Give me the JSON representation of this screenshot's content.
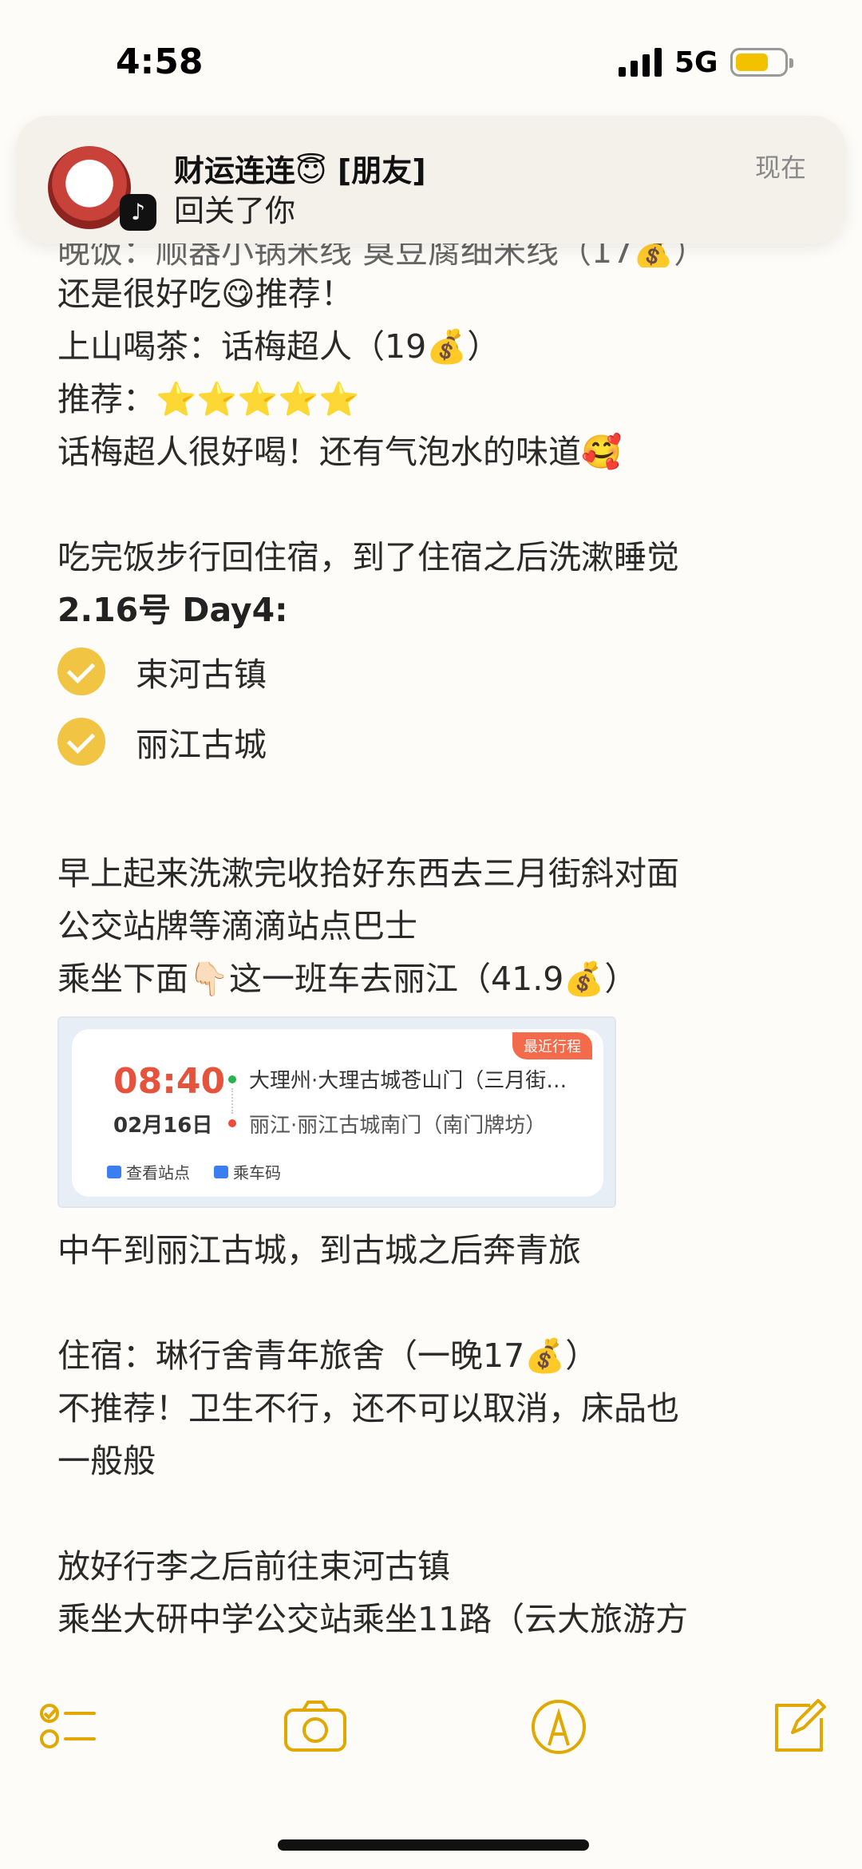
{
  "status_bar": {
    "time": "4:58",
    "network": "5G"
  },
  "notification": {
    "app_icon": "tiktok-icon",
    "sender": "财运连连😇 [朋友]",
    "message": "回关了你",
    "time": "现在"
  },
  "note": {
    "cut_top_line": "晚饭：顺器小锅米线 臭豆腐细米线（17💰）",
    "lines_a": [
      "还是很好吃😋推荐！",
      "上山喝茶：话梅超人（19💰）",
      "推荐：⭐⭐⭐⭐⭐",
      "话梅超人很好喝！还有气泡水的味道🥰"
    ],
    "walk_line": "吃完饭步行回住宿，到了住宿之后洗漱睡觉",
    "day_heading": "2.16号 Day4:",
    "checklist": [
      "束河古镇",
      "丽江古城"
    ],
    "lines_b": [
      "早上起来洗漱完收拾好东西去三月街斜对面",
      "公交站牌等滴滴站点巴士",
      "乘坐下面👇🏻这一班车去丽江（41.9💰）"
    ],
    "ticket": {
      "tag": "最近行程",
      "time": "08:40",
      "date": "02月16日",
      "from": "大理州·大理古城苍山门（三月街…",
      "to": "丽江·丽江古城南门（南门牌坊）",
      "btn_station": "查看站点",
      "btn_code": "乘车码"
    },
    "lines_c": [
      "中午到丽江古城，到古城之后奔青旅"
    ],
    "lines_d": [
      "住宿：琳行舍青年旅舍（一晚17💰）",
      "不推荐！卫生不行，还不可以取消，床品也",
      "一般般"
    ],
    "lines_e": [
      "放好行李之后前往束河古镇",
      "乘坐大研中学公交站乘坐11路（云大旅游方"
    ]
  },
  "toolbar": {
    "icons": [
      "checklist-icon",
      "camera-icon",
      "markup-icon",
      "compose-icon"
    ],
    "accent": "#e0a800"
  }
}
